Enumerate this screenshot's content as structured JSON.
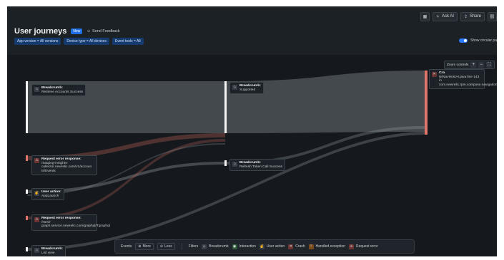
{
  "toolbar": {
    "ask_ai": "Ask AI",
    "share": "Share"
  },
  "header": {
    "title": "User journeys",
    "badge": "New",
    "feedback": "Send Feedback"
  },
  "filters": [
    "App version = All versions",
    "Device type = All devices",
    "Event tools = All"
  ],
  "toggle": {
    "label": "Show circular pa"
  },
  "zoom": {
    "label": "Zoom controls",
    "plus": "+",
    "minus": "−"
  },
  "nodes": {
    "retrieve": {
      "title": "Breadcrumb:",
      "text": "Retrieve Accounts Success"
    },
    "supported": {
      "title": "Breadcrumb:",
      "text": "Supported"
    },
    "error1": {
      "title": "Request error response:",
      "text": "/Staging-insights-collector.newrelic.com/v1/accoun ts/Events"
    },
    "applaunch": {
      "title": "User action:",
      "text": "AppLaunch"
    },
    "error2": {
      "title": "Request error response:",
      "text": "/Nerd-graph.service.newrelic.com/graphql/Tgraphql"
    },
    "listview": {
      "title": "Breadcrumb:",
      "text": "List view"
    },
    "refresh": {
      "title": "Breadcrumb:",
      "text": "Refresh Token Call Success"
    },
    "crash": {
      "title": "Cra",
      "text": "NrNavHostAI.java line 143 in com.newrelic.rpm.compose.navigation.NrNavHost.NrNavHost"
    }
  },
  "legend": {
    "events_label": "Events",
    "more": "More",
    "less": "Less",
    "filters_label": "Filters",
    "items": [
      "Breadcrumb",
      "Interaction",
      "User action",
      "Crash",
      "Handled exception",
      "Request error"
    ]
  },
  "colors": {
    "background": "#15191d",
    "flow": "#a9b1b7",
    "error_flow": "#c0625a",
    "accent": "#1f6fe5"
  }
}
